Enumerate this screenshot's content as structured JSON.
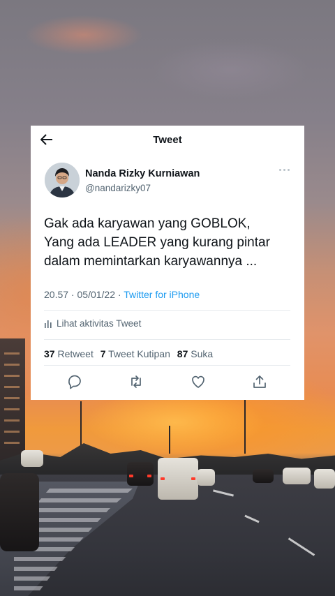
{
  "header": {
    "title": "Tweet"
  },
  "author": {
    "name": "Nanda Rizky Kurniawan",
    "handle": "@nandarizky07"
  },
  "tweet": {
    "lines": [
      "Gak ada karyawan yang GOBLOK,",
      "Yang ada LEADER yang kurang pintar",
      "dalam memintarkan karyawannya ..."
    ]
  },
  "meta": {
    "time": "20.57",
    "separator1": " · ",
    "date": "05/01/22",
    "separator2": " · ",
    "source": "Twitter for iPhone"
  },
  "activity": {
    "label": "Lihat aktivitas Tweet"
  },
  "stats": {
    "retweets_count": "37",
    "retweets_label": "Retweet",
    "quotes_count": "7",
    "quotes_label": "Tweet Kutipan",
    "likes_count": "87",
    "likes_label": "Suka"
  },
  "colors": {
    "link": "#1d9bf0",
    "secondary_text": "#536471",
    "primary_text": "#0f1419"
  },
  "icons": [
    "back-arrow-icon",
    "more-icon",
    "activity-icon",
    "reply-icon",
    "retweet-icon",
    "like-icon",
    "share-icon"
  ]
}
